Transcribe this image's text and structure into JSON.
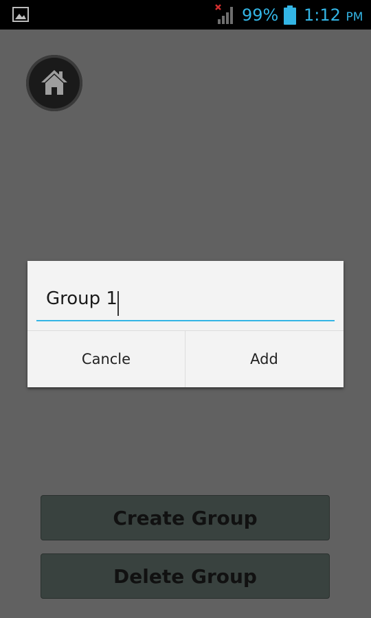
{
  "status_bar": {
    "battery_percent": "99%",
    "time": "1:12",
    "ampm": "PM",
    "notification_icon": "image-icon",
    "signal_icon": "signal-no-data-icon",
    "battery_icon": "battery-icon",
    "accent_color": "#33b5e5"
  },
  "home_button": {
    "icon": "home-icon"
  },
  "dialog": {
    "input_value": "Group 1",
    "cancel_label": "Cancle",
    "add_label": "Add"
  },
  "actions": {
    "create_label": "Create Group",
    "delete_label": "Delete Group"
  }
}
